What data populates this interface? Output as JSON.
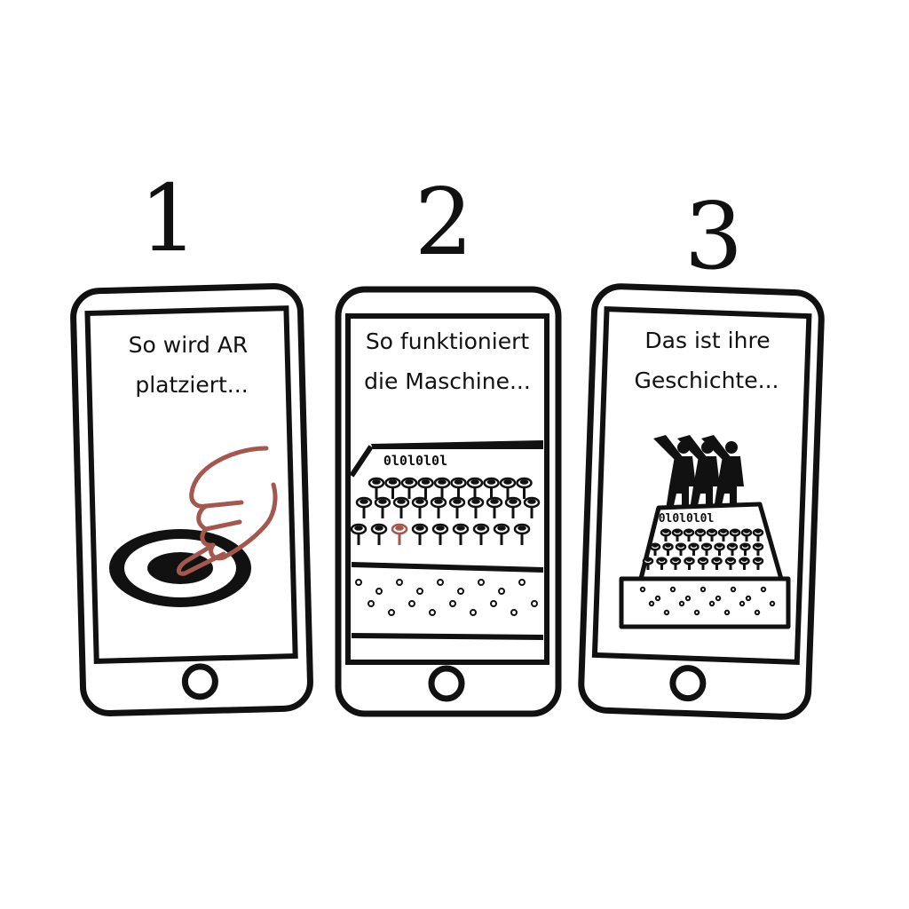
{
  "steps": [
    {
      "number": "1",
      "caption_line1": "So wird AR",
      "caption_line2": "platziert..."
    },
    {
      "number": "2",
      "caption_line1": "So funktioniert",
      "caption_line2": "die Maschine..."
    },
    {
      "number": "3",
      "caption_line1": "Das ist ihre",
      "caption_line2": "Geschichte..."
    }
  ],
  "machine_label": "0l0l0l0l",
  "colors": {
    "ink": "#111111",
    "accent": "#a5574d",
    "paper": "#ffffff"
  },
  "icons": [
    "target-icon",
    "pointing-hand-icon",
    "enigma-machine-icon",
    "soldiers-silhouette-icon",
    "home-button-icon"
  ]
}
